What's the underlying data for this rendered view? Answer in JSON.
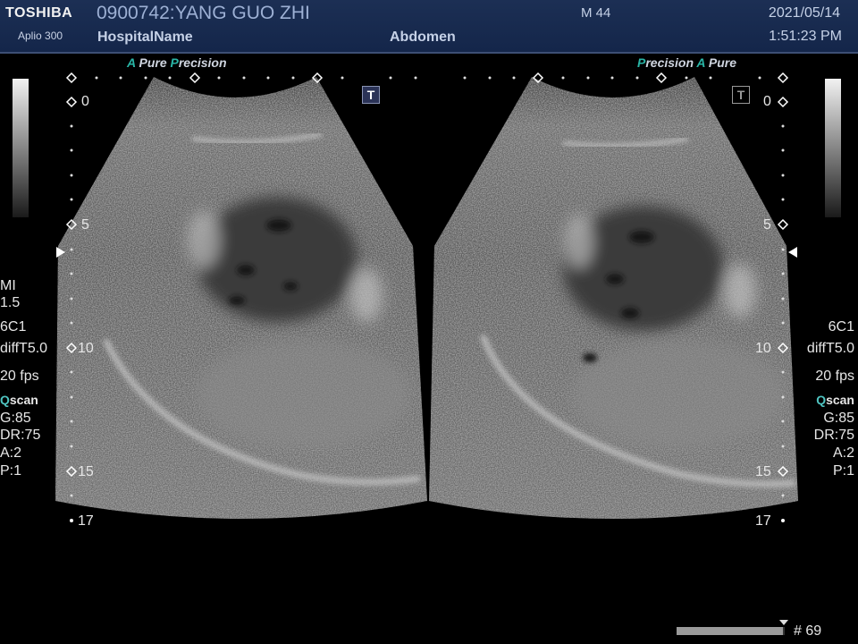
{
  "header": {
    "brand": "TOSHIBA",
    "model": "Aplio 300",
    "patient": "0900742:YANG GUO ZHI",
    "hospital": "HospitalName",
    "exam": "Abdomen",
    "mode": "M 44",
    "date": "2021/05/14",
    "time": "1:51:23 PM"
  },
  "tags": {
    "left": {
      "a": "A",
      "pure": " Pure ",
      "p": "P",
      "recision": "recision"
    },
    "right": {
      "p": "P",
      "recision": "recision",
      "a": "A",
      "pure": " Pure"
    }
  },
  "icons": {
    "t_left": "T",
    "t_right": "T"
  },
  "depth": {
    "d0": "0",
    "d5": "5",
    "d10": "10",
    "d15": "15",
    "d17": "17"
  },
  "params": {
    "mi": "MI",
    "mi_value": "1.5",
    "probe": "6C1",
    "preset": "diffT5.0",
    "fps": "20 fps",
    "q": "Q",
    "scan": "scan",
    "gain": "G:85",
    "dr": "DR:75",
    "a": "A:2",
    "p": "P:1"
  },
  "cine": {
    "frame": "# 69",
    "position": 0.98
  },
  "colors": {
    "header_bg": "#1a2d52",
    "accent": "#29b5a6",
    "text": "#c5d1e7"
  }
}
